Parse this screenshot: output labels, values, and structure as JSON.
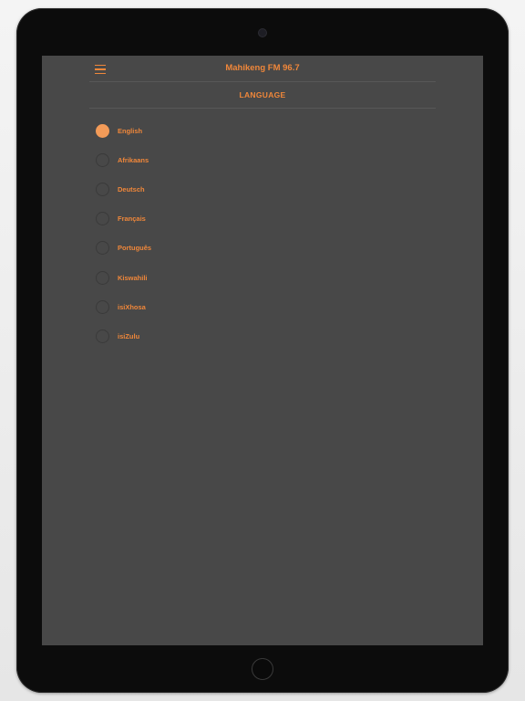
{
  "app": {
    "title": "Mahikeng FM 96.7"
  },
  "section": {
    "title": "LANGUAGE"
  },
  "languages": [
    {
      "label": "English",
      "selected": true
    },
    {
      "label": "Afrikaans",
      "selected": false
    },
    {
      "label": "Deutsch",
      "selected": false
    },
    {
      "label": "Français",
      "selected": false
    },
    {
      "label": "Português",
      "selected": false
    },
    {
      "label": "Kiswahili",
      "selected": false
    },
    {
      "label": "isiXhosa",
      "selected": false
    },
    {
      "label": "isiZulu",
      "selected": false
    }
  ],
  "colors": {
    "accent": "#f0873a",
    "screen_background": "#484848",
    "device_bezel": "#0c0c0c"
  },
  "icons": {
    "menu": "hamburger-menu-icon"
  }
}
